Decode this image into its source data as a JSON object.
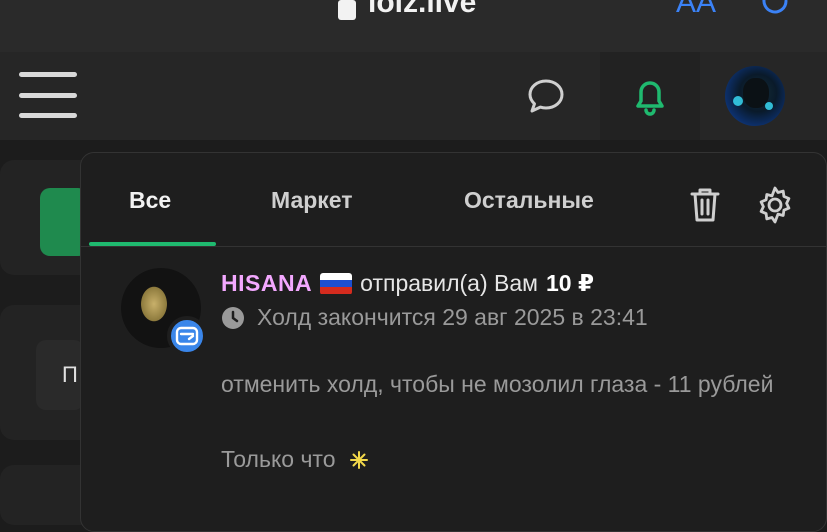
{
  "browser": {
    "url": "lolz.live",
    "text_size_label": "AA"
  },
  "background": {
    "partial_button_text": "П"
  },
  "notifications": {
    "tabs": [
      {
        "label": "Все",
        "active": true
      },
      {
        "label": "Маркет",
        "active": false
      },
      {
        "label": "Остальные",
        "active": false
      }
    ],
    "items": [
      {
        "username": "HISANA",
        "flag": "ru",
        "message": "отправил(а) Вам",
        "amount": "10 ₽",
        "hold_text": "Холд закончится 29 авг 2025 в 23:41",
        "comment": "отменить холд, чтобы не мозолил глаза - 11 рублей",
        "time": "Только что"
      }
    ]
  },
  "colors": {
    "accent_green": "#1fba6f",
    "username_pink": "#f3a8ff",
    "badge_blue": "#3a86ea"
  }
}
